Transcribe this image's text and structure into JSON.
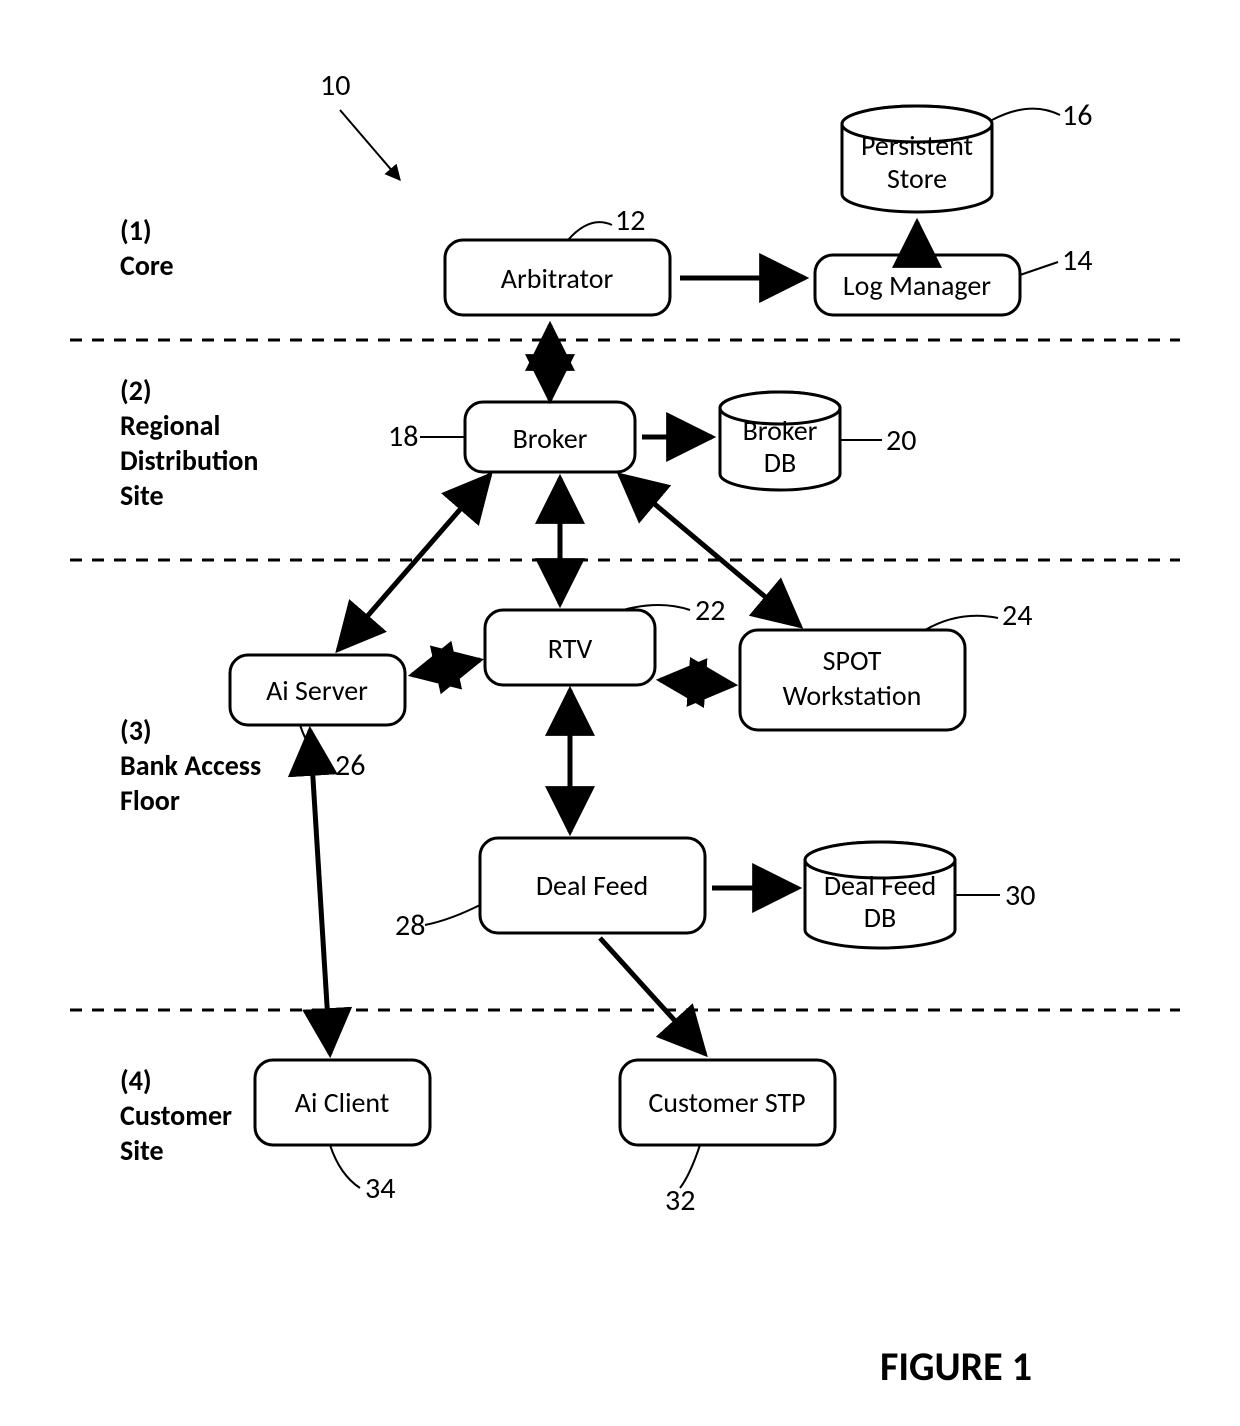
{
  "figure_label": "FIGURE 1",
  "layers": {
    "core": {
      "id": "(1)",
      "name": "Core"
    },
    "regional": {
      "id": "(2)",
      "name1": "Regional",
      "name2": "Distribution",
      "name3": "Site"
    },
    "bank": {
      "id": "(3)",
      "name1": "Bank Access",
      "name2": "Floor"
    },
    "customer": {
      "id": "(4)",
      "name1": "Customer",
      "name2": "Site"
    }
  },
  "nodes": {
    "arbitrator": {
      "label": "Arbitrator",
      "ref": "12"
    },
    "logmanager": {
      "label": "Log Manager",
      "ref": "14"
    },
    "persistent": {
      "label1": "Persistent",
      "label2": "Store",
      "ref": "16"
    },
    "broker": {
      "label": "Broker",
      "ref": "18"
    },
    "brokerdb": {
      "label1": "Broker",
      "label2": "DB",
      "ref": "20"
    },
    "rtv": {
      "label": "RTV",
      "ref": "22"
    },
    "spot": {
      "label1": "SPOT",
      "label2": "Workstation",
      "ref": "24"
    },
    "aiserver": {
      "label": "Ai Server",
      "ref": "26"
    },
    "dealfeed": {
      "label": "Deal Feed",
      "ref": "28"
    },
    "dealfeeddb": {
      "label1": "Deal Feed",
      "label2": "DB",
      "ref": "30"
    },
    "customerstp": {
      "label": "Customer STP",
      "ref": "32"
    },
    "aiclient": {
      "label": "Ai Client",
      "ref": "34"
    }
  },
  "overall_ref": "10"
}
